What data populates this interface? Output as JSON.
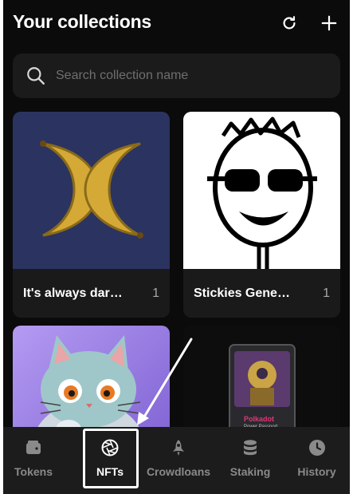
{
  "header": {
    "title": "Your collections",
    "refresh_icon": "refresh-icon",
    "add_icon": "plus-icon"
  },
  "search": {
    "placeholder": "Search collection name",
    "value": "",
    "icon": "search-icon"
  },
  "collections": [
    {
      "name": "It's always dar…",
      "count": "1",
      "art": "crescent-bananas"
    },
    {
      "name": "Stickies Gene…",
      "count": "1",
      "art": "sunglasses-face-sketch"
    },
    {
      "name": "",
      "count": "",
      "art": "cartoon-cat"
    },
    {
      "name": "",
      "count": "",
      "art": "polkadot-power-passport",
      "art_text": [
        "Polkadot",
        "Power Passport"
      ]
    }
  ],
  "nav": {
    "items": [
      {
        "label": "Tokens",
        "icon": "wallet-icon",
        "active": false
      },
      {
        "label": "NFTs",
        "icon": "aperture-icon",
        "active": true
      },
      {
        "label": "Crowdloans",
        "icon": "rocket-icon",
        "active": false
      },
      {
        "label": "Staking",
        "icon": "database-icon",
        "active": false
      },
      {
        "label": "History",
        "icon": "clock-icon",
        "active": false
      }
    ]
  },
  "colors": {
    "background": "#0b0b0b",
    "surface": "#1b1b1b",
    "nav_background": "#1c1c1c",
    "text_primary": "#ffffff",
    "text_muted": "#8a8a8a",
    "card1_bg": "#2b3360",
    "card1_art": "#d4a935",
    "card3_bg": "#9a7fe0",
    "card4_accent": "#e0357a"
  }
}
